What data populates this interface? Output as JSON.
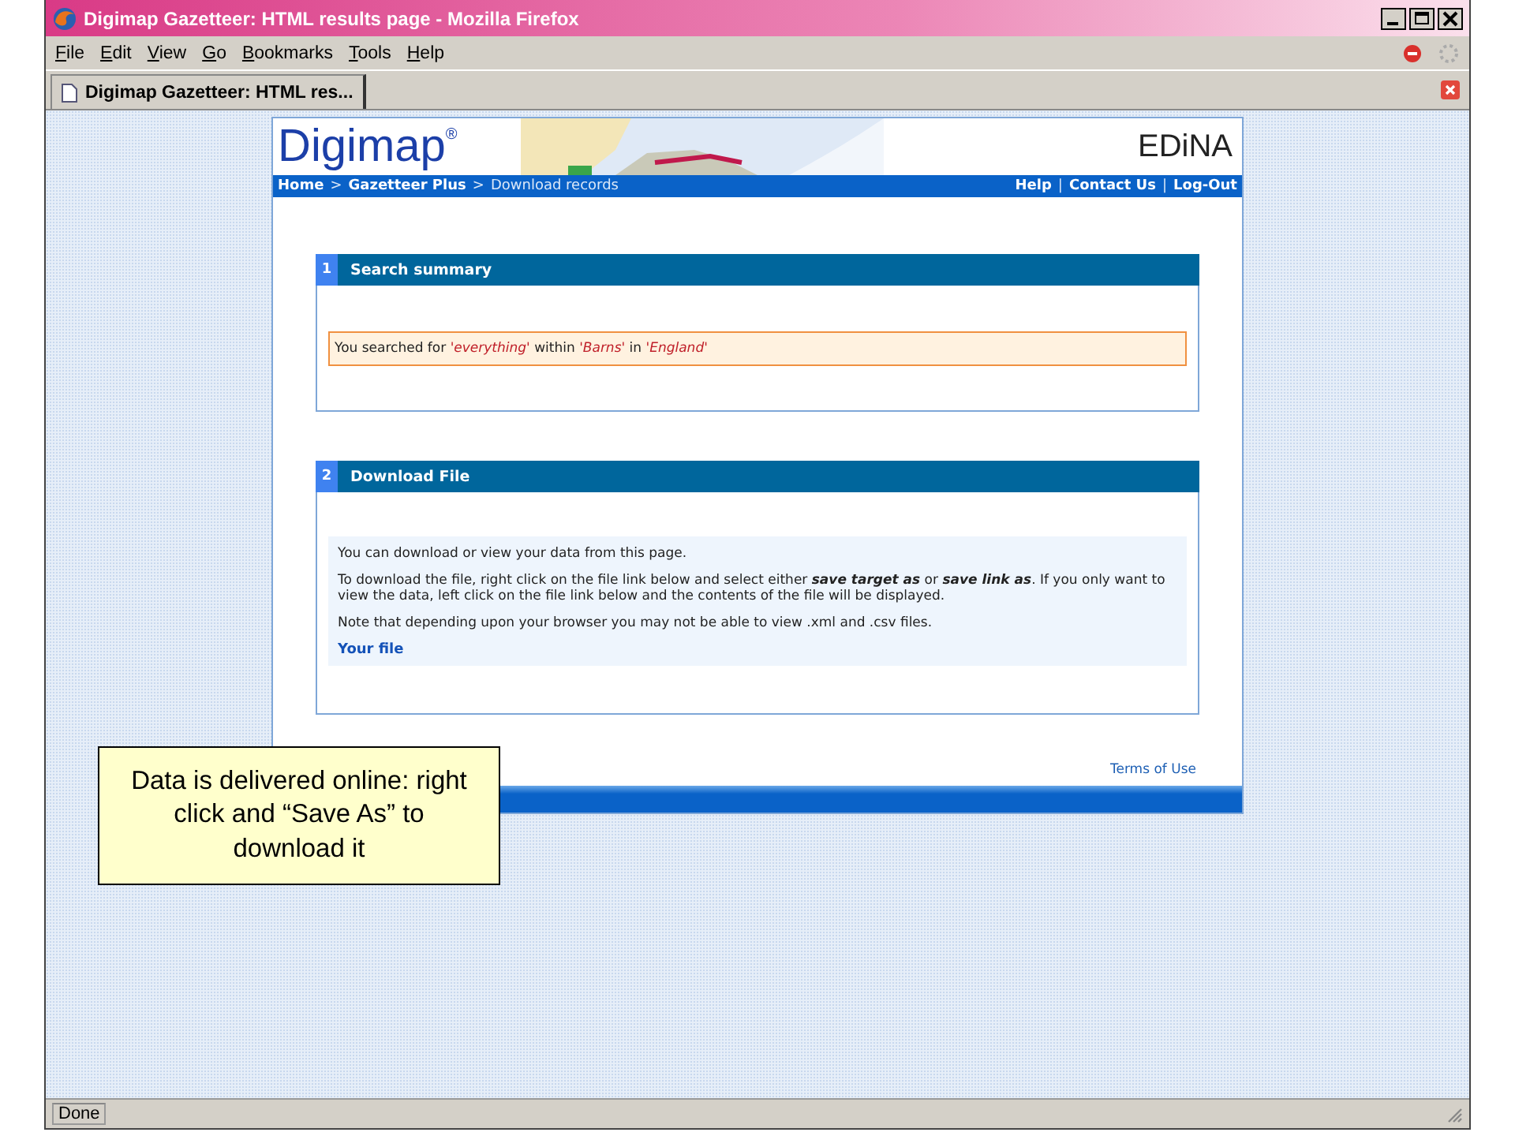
{
  "window": {
    "title": "Digimap Gazetteer: HTML results page - Mozilla Firefox"
  },
  "menu": [
    "File",
    "Edit",
    "View",
    "Go",
    "Bookmarks",
    "Tools",
    "Help"
  ],
  "tabs": [
    {
      "label": "Digimap Gazetteer: HTML res...",
      "selected": true
    }
  ],
  "page": {
    "logo": "Digimap$^{®}$",
    "partner_logo": "EDiNA",
    "breadcrumbs": [
      {
        "label": "Home",
        "selected": false
      },
      {
        "label": "Gazetteer Plus",
        "selected": false
      },
      {
        "label": "Download records",
        "selected": true
      }
    ],
    "breadcrumb_separator": ">",
    "top_links": [
      "Help",
      "Contact Us",
      "Log-Out"
    ],
    "top_link_separator": "|",
    "panels": [
      {
        "number": "1",
        "title": "Search summary",
        "kind": "summary",
        "text": "You searched for *'everything'* within *'Barns'* in *'England'*"
      },
      {
        "number": "2",
        "title": "Download File",
        "kind": "download",
        "paragraphs": [
          "You can download or view your data from this page.",
          "To download the file, right click on the file link below and select either **save target as** or **save link as**. If you only want to view the data, left click on the file link below and the contents of the file will be displayed.",
          "Note that depending upon your browser you may not be able to view .xml and .csv files."
        ],
        "link": "Your file"
      }
    ],
    "footer_link": "Terms of Use"
  },
  "callout": "Data is delivered online: right click and “Save As” to download it",
  "status_bar": "Done"
}
